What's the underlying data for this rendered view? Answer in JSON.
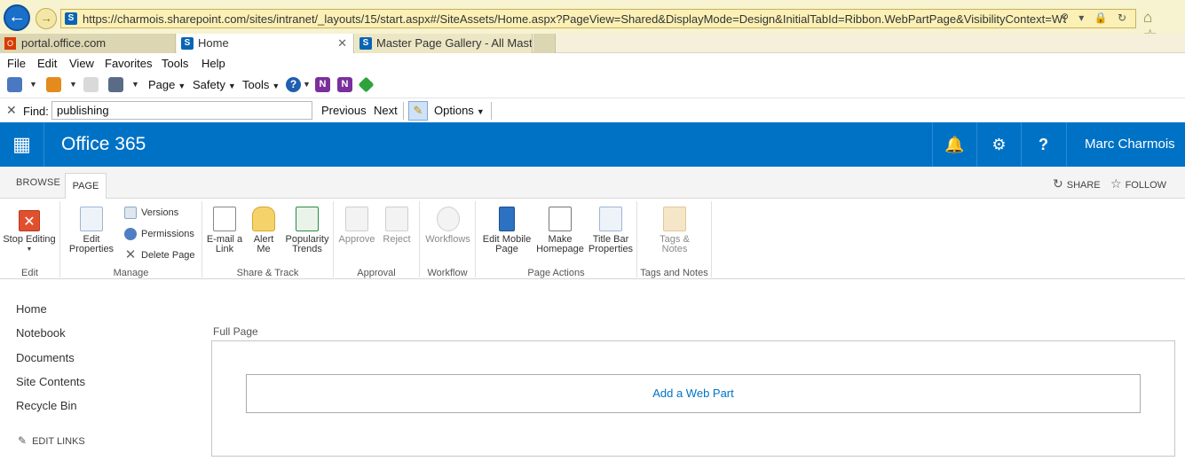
{
  "browser": {
    "url": "https://charmois.sharepoint.com/sites/intranet/_layouts/15/start.aspx#/SiteAssets/Home.aspx?PageView=Shared&DisplayMode=Design&InitialTabId=Ribbon.WebPartPage&VisibilityContext=WSSWebPartPage",
    "tabs": [
      {
        "label": "portal.office.com"
      },
      {
        "label": "Home"
      },
      {
        "label": "Master Page Gallery - All Mast..."
      }
    ],
    "menu": [
      "File",
      "Edit",
      "View",
      "Favorites",
      "Tools",
      "Help"
    ],
    "commands": {
      "page": "Page",
      "safety": "Safety",
      "tools": "Tools"
    },
    "find": {
      "label": "Find:",
      "value": "publishing",
      "previous": "Previous",
      "next": "Next",
      "options": "Options"
    }
  },
  "suite": {
    "brand": "Office 365",
    "user": "Marc Charmois",
    "help_glyph": "?"
  },
  "ribbon": {
    "tabs": [
      "BROWSE",
      "PAGE"
    ],
    "share": "SHARE",
    "follow": "FOLLOW",
    "groups": {
      "edit": {
        "label": "Edit",
        "stop_editing": "Stop Editing"
      },
      "manage": {
        "label": "Manage",
        "edit_properties_1": "Edit",
        "edit_properties_2": "Properties",
        "versions": "Versions",
        "permissions": "Permissions",
        "delete_page": "Delete Page"
      },
      "share_track": {
        "label": "Share & Track",
        "email_1": "E-mail a",
        "email_2": "Link",
        "alert_1": "Alert",
        "alert_2": "Me",
        "popularity_1": "Popularity",
        "popularity_2": "Trends"
      },
      "approval": {
        "label": "Approval",
        "approve": "Approve",
        "reject": "Reject"
      },
      "workflow": {
        "label": "Workflow",
        "workflows": "Workflows"
      },
      "page_actions": {
        "label": "Page Actions",
        "edit_mobile_1": "Edit Mobile",
        "edit_mobile_2": "Page",
        "make_home_1": "Make",
        "make_home_2": "Homepage",
        "title_bar_1": "Title Bar",
        "title_bar_2": "Properties"
      },
      "tags_notes": {
        "label": "Tags and Notes",
        "tags_1": "Tags &",
        "tags_2": "Notes"
      }
    }
  },
  "leftnav": {
    "items": [
      "Home",
      "Notebook",
      "Documents",
      "Site Contents",
      "Recycle Bin"
    ],
    "edit_links": "EDIT LINKS"
  },
  "main": {
    "zone_title": "Full Page",
    "add_web_part": "Add a Web Part"
  }
}
